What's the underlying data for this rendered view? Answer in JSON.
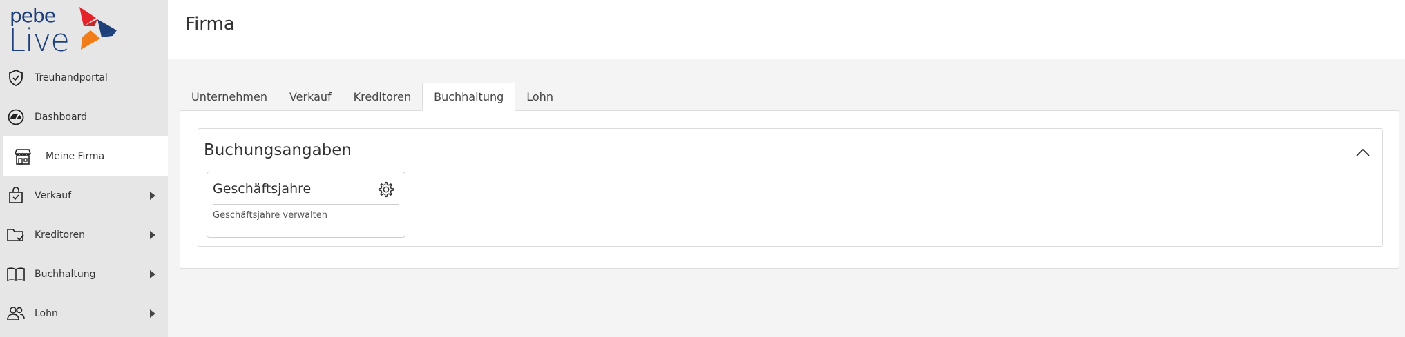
{
  "logo": {
    "line1": "pebe",
    "line2": "Live"
  },
  "sidebar": {
    "items": [
      {
        "label": "Treuhandportal",
        "icon": "shield-check-icon"
      },
      {
        "label": "Dashboard",
        "icon": "gauge-icon"
      },
      {
        "label": "Meine Firma",
        "icon": "store-icon",
        "active": true
      },
      {
        "label": "Verkauf",
        "icon": "shopping-bag-check-icon",
        "expandable": true
      },
      {
        "label": "Kreditoren",
        "icon": "folder-check-icon",
        "expandable": true
      },
      {
        "label": "Buchhaltung",
        "icon": "book-open-icon",
        "expandable": true
      },
      {
        "label": "Lohn",
        "icon": "users-icon",
        "expandable": true
      }
    ]
  },
  "header": {
    "title": "Firma"
  },
  "tabs": [
    {
      "label": "Unternehmen"
    },
    {
      "label": "Verkauf"
    },
    {
      "label": "Kreditoren"
    },
    {
      "label": "Buchhaltung",
      "active": true
    },
    {
      "label": "Lohn"
    }
  ],
  "section": {
    "title": "Buchungsangaben",
    "cards": [
      {
        "title": "Geschäftsjahre",
        "description": "Geschäftsjahre verwalten",
        "icon": "gear-icon"
      }
    ]
  },
  "colors": {
    "brand_blue": "#1d3f7a",
    "brand_red": "#e3242b",
    "brand_orange": "#f07d1a",
    "sidebar_bg": "#e6e6e6"
  }
}
